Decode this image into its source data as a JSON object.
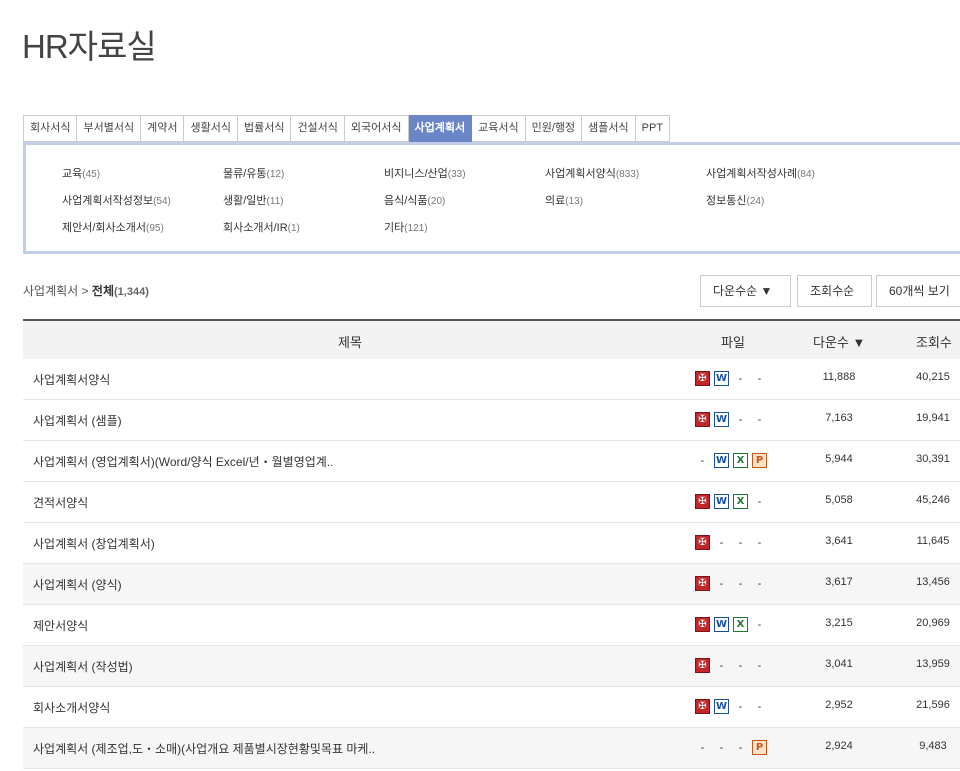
{
  "page": {
    "title": "HR자료실"
  },
  "tabs": [
    {
      "label": "회사서식",
      "active": false
    },
    {
      "label": "부서별서식",
      "active": false
    },
    {
      "label": "계약서",
      "active": false
    },
    {
      "label": "생활서식",
      "active": false
    },
    {
      "label": "법률서식",
      "active": false
    },
    {
      "label": "건설서식",
      "active": false
    },
    {
      "label": "외국어서식",
      "active": false
    },
    {
      "label": "사업계획서",
      "active": true
    },
    {
      "label": "교육서식",
      "active": false
    },
    {
      "label": "민원/행정",
      "active": false
    },
    {
      "label": "샘플서식",
      "active": false
    },
    {
      "label": "PPT",
      "active": false
    }
  ],
  "categories": [
    {
      "name": "교육",
      "count": "(45)"
    },
    {
      "name": "물류/유통",
      "count": "(12)"
    },
    {
      "name": "비지니스/산업",
      "count": "(33)"
    },
    {
      "name": "사업계획서양식",
      "count": "(833)"
    },
    {
      "name": "사업계획서작성사례",
      "count": "(84)"
    },
    {
      "name": "사업계획서작성정보",
      "count": "(54)"
    },
    {
      "name": "생활/일반",
      "count": "(11)"
    },
    {
      "name": "음식/식품",
      "count": "(20)"
    },
    {
      "name": "의료",
      "count": "(13)"
    },
    {
      "name": "정보통신",
      "count": "(24)"
    },
    {
      "name": "제안서/회사소개서",
      "count": "(95)"
    },
    {
      "name": "회사소개서/IR",
      "count": "(1)"
    },
    {
      "name": "기타",
      "count": "(121)"
    }
  ],
  "breadcrumb": {
    "section": "사업계획서",
    "sep": ">",
    "current": "전체",
    "total": "(1,344)"
  },
  "controls": {
    "sort_download": "다운수순 ▼",
    "sort_views": "조회수순",
    "per_page": "60개씩 보기"
  },
  "table": {
    "headers": {
      "title": "제목",
      "file": "파일",
      "downloads": "다운수 ▼",
      "views": "조회수"
    },
    "rows": [
      {
        "title": "사업계획서양식",
        "files": [
          "pdf",
          "word",
          "-",
          "-"
        ],
        "downloads": "11,888",
        "views": "40,215"
      },
      {
        "title": "사업계획서 (샘플)",
        "files": [
          "pdf",
          "word",
          "-",
          "-"
        ],
        "downloads": "7,163",
        "views": "19,941"
      },
      {
        "title": "사업계획서 (영업계획서)(Word/양식 Excel/년・월별영업계..",
        "files": [
          "-",
          "word",
          "excel",
          "ppt"
        ],
        "downloads": "5,944",
        "views": "30,391"
      },
      {
        "title": "견적서양식",
        "files": [
          "pdf",
          "word",
          "excel",
          "-"
        ],
        "downloads": "5,058",
        "views": "45,246"
      },
      {
        "title": "사업계획서 (창업계획서)",
        "files": [
          "pdf",
          "-",
          "-",
          "-"
        ],
        "downloads": "3,641",
        "views": "11,645"
      },
      {
        "title": "사업계획서 (양식)",
        "files": [
          "pdf",
          "-",
          "-",
          "-"
        ],
        "downloads": "3,617",
        "views": "13,456"
      },
      {
        "title": "제안서양식",
        "files": [
          "pdf",
          "word",
          "excel",
          "-"
        ],
        "downloads": "3,215",
        "views": "20,969"
      },
      {
        "title": "사업계획서 (작성법)",
        "files": [
          "pdf",
          "-",
          "-",
          "-"
        ],
        "downloads": "3,041",
        "views": "13,959"
      },
      {
        "title": "회사소개서양식",
        "files": [
          "pdf",
          "word",
          "-",
          "-"
        ],
        "downloads": "2,952",
        "views": "21,596"
      },
      {
        "title": "사업계획서 (제조업,도・소매)(사업개요 제품별시장현황및목표 마케..",
        "files": [
          "-",
          "-",
          "-",
          "ppt"
        ],
        "downloads": "2,924",
        "views": "9,483"
      }
    ]
  },
  "file_icons": {
    "pdf": "✠",
    "word": "W",
    "excel": "X",
    "ppt": "P"
  }
}
